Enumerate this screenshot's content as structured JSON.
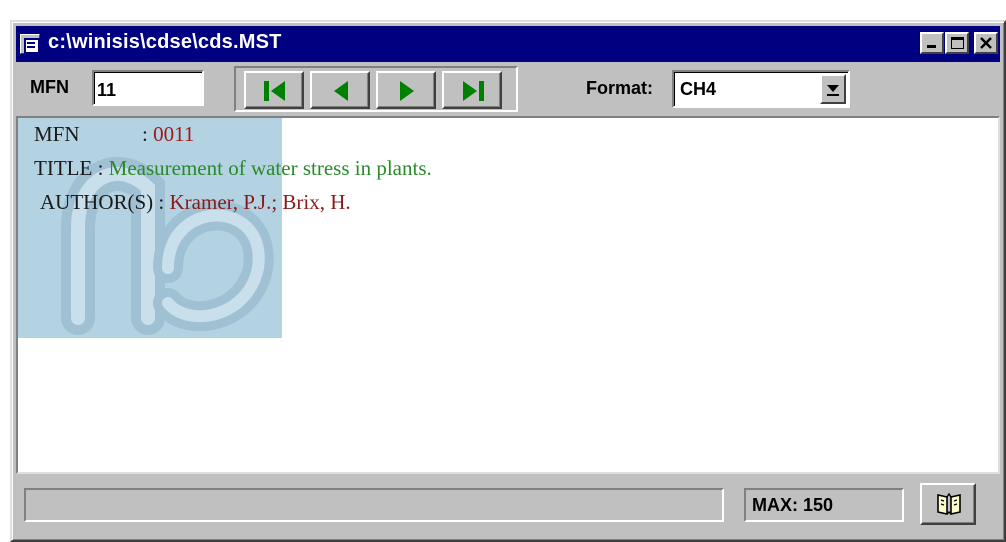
{
  "window": {
    "title": "c:\\winisis\\cdse\\cds.MST",
    "controls": [
      "minimize-icon",
      "maximize-icon",
      "close-icon"
    ]
  },
  "toolbar": {
    "mfn_label": "MFN",
    "mfn_value": "11",
    "nav_buttons": [
      "first-record-icon",
      "previous-record-icon",
      "next-record-icon",
      "last-record-icon"
    ],
    "nav_color": "#008000",
    "format_label": "Format:",
    "format_value": "CH4"
  },
  "record": {
    "mfn_label": "MFN",
    "mfn_sep": ": ",
    "mfn_value": "0011",
    "title_label": "TITLE",
    "title_sep": ": ",
    "title_value": "Measurement of water stress in plants.",
    "author_label": "AUTHOR(S)",
    "author_sep": ": ",
    "author_value": "Kramer, P.J.; Brix, H."
  },
  "colors": {
    "titlebar": "#000080",
    "mfn_value": "#a01818",
    "title_value": "#2a8a2a",
    "author_value": "#8a1a1a",
    "watermark": "#b3d2e2"
  },
  "statusbar": {
    "message": "",
    "max_label": "MAX: 150",
    "book_button_icon": "book-icon"
  }
}
